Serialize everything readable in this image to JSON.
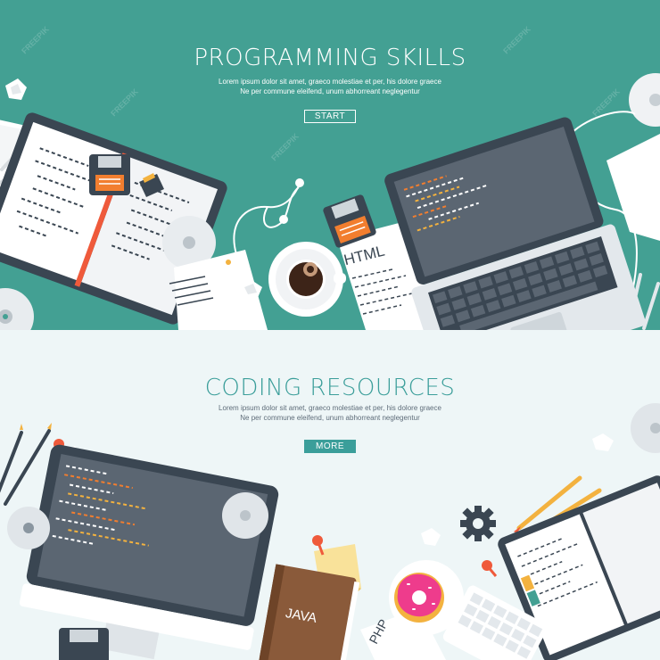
{
  "colors": {
    "teal_bg": "#43a093",
    "light_bg": "#eef6f7",
    "accent_teal": "#3b9e9a",
    "dark_navy": "#3a4652",
    "orange": "#f27e2f",
    "red_orange": "#ef5a3b",
    "gold": "#f3b23f",
    "pink": "#ee3c8c",
    "brown": "#8a5a3a",
    "white": "#ffffff"
  },
  "top_banner": {
    "title": "PROGRAMMING SKILLS",
    "subtitle_line1": "Lorem ipsum dolor sit amet, graeco molestiae et per, his dolore graece",
    "subtitle_line2": "Ne per commune eleifend, unum abhorreant neglegentur",
    "button_label": "START",
    "file_label": "HTML"
  },
  "bottom_banner": {
    "title": "CODING RESOURCES",
    "subtitle_line1": "Lorem ipsum dolor sit amet, graeco molestiae et per, his dolore graece",
    "subtitle_line2": "Ne per commune eleifend, unum abhorreant neglegentur",
    "button_label": "MORE",
    "book_label": "JAVA",
    "paper_label": "PHP"
  },
  "watermark": "FREEPIK",
  "icons": [
    "laptop-icon",
    "open-notebook-icon",
    "floppy-disk-icon",
    "sd-card-icon",
    "earphones-icon",
    "coffee-cup-icon",
    "cd-disc-icon",
    "crumpled-paper-icon",
    "pencil-icon",
    "monitor-icon",
    "pushpin-icon",
    "sticky-note-icon",
    "gear-icon",
    "donut-icon",
    "keyboard-icon",
    "book-icon"
  ]
}
